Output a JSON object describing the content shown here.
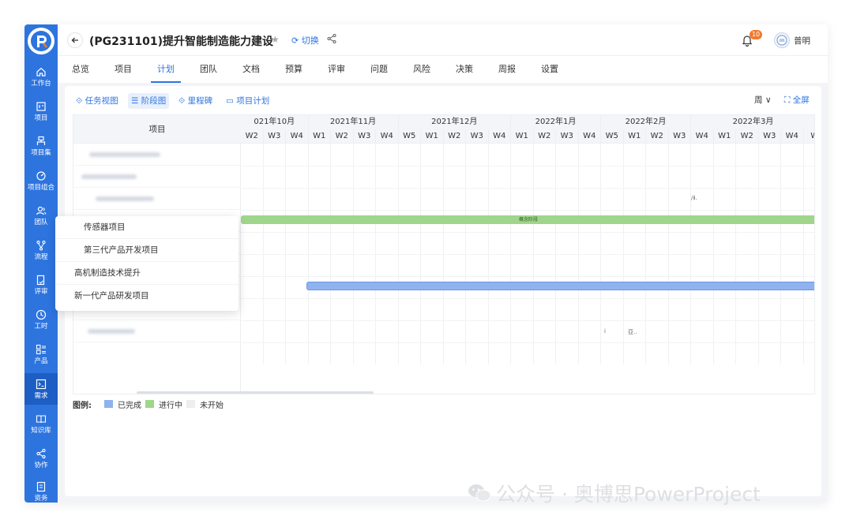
{
  "sidebar": {
    "items": [
      {
        "label": "工作台",
        "icon": "home-icon"
      },
      {
        "label": "项目",
        "icon": "project-icon"
      },
      {
        "label": "项目集",
        "icon": "program-icon"
      },
      {
        "label": "项目组合",
        "icon": "portfolio-icon"
      },
      {
        "label": "团队",
        "icon": "team-icon"
      },
      {
        "label": "流程",
        "icon": "flow-icon"
      },
      {
        "label": "评审",
        "icon": "review-icon"
      },
      {
        "label": "工时",
        "icon": "clock-icon"
      },
      {
        "label": "产品",
        "icon": "product-icon"
      },
      {
        "label": "需求",
        "icon": "requirement-icon"
      },
      {
        "label": "知识库",
        "icon": "book-icon"
      },
      {
        "label": "协作",
        "icon": "share-icon"
      },
      {
        "label": "资务",
        "icon": "finance-icon"
      }
    ],
    "active_index": 9
  },
  "header": {
    "title": "(PG231101)提升智能制造能力建设",
    "switch_label": "切换",
    "notification_count": "10",
    "user_name": "普明"
  },
  "tabs": [
    {
      "label": "总览"
    },
    {
      "label": "项目"
    },
    {
      "label": "计划"
    },
    {
      "label": "团队"
    },
    {
      "label": "文档"
    },
    {
      "label": "预算"
    },
    {
      "label": "评审"
    },
    {
      "label": "问题"
    },
    {
      "label": "风险"
    },
    {
      "label": "决策"
    },
    {
      "label": "周报"
    },
    {
      "label": "设置"
    }
  ],
  "active_tab": 2,
  "toolbar": {
    "views": [
      {
        "label": "任务视图",
        "icon": "task-view-icon"
      },
      {
        "label": "阶段图",
        "icon": "stage-icon"
      },
      {
        "label": "里程碑",
        "icon": "milestone-icon"
      },
      {
        "label": "项目计划",
        "icon": "plan-icon"
      }
    ],
    "active_view": 1,
    "period_label": "周",
    "fullscreen_label": "全屏"
  },
  "gantt": {
    "column_header": "项目",
    "months": [
      "021年10月",
      "2021年11月",
      "2021年12月",
      "2022年1月",
      "2022年2月",
      "2022年3月"
    ],
    "weeks": [
      "W2",
      "W3",
      "W4",
      "W1",
      "W2",
      "W3",
      "W4",
      "W5",
      "W1",
      "W2",
      "W3",
      "W4",
      "W1",
      "W2",
      "W3",
      "W4",
      "W5",
      "W1",
      "W2",
      "W3",
      "W4",
      "W1",
      "W2",
      "W3",
      "W4",
      "W"
    ],
    "green_bar_label": "概念阶段",
    "small_labels": [
      "/ⅱ.",
      "i",
      "亞.."
    ]
  },
  "dropdown": {
    "items": [
      "传感器项目",
      "第三代产品开发项目",
      "高机制造技术提升",
      "新一代产品研发项目"
    ]
  },
  "legend": {
    "title": "图例:",
    "items": [
      {
        "label": "已完成",
        "color": "#8fb3ef"
      },
      {
        "label": "进行中",
        "color": "#9fd68b"
      },
      {
        "label": "未开始",
        "color": "#eeeeee"
      }
    ]
  },
  "watermark": {
    "text": "公众号 · 奥博思PowerProject"
  },
  "colors": {
    "brand": "#2d74df",
    "sidebar_active": "#1d5ec4",
    "badge": "#f07b31"
  }
}
